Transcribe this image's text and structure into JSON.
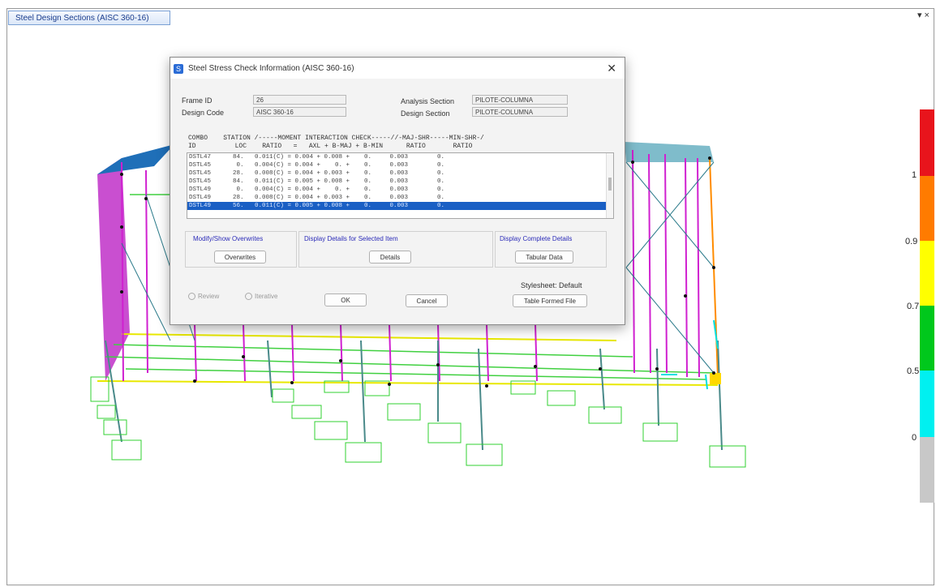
{
  "window": {
    "tab_title": "Steel Design Sections (AISC 360-16)",
    "controls": "▾ ×"
  },
  "legend": {
    "colors": [
      "#e8141c",
      "#ff7b00",
      "#ffff00",
      "#00c81c",
      "#00f0f0",
      "#c8c8c8"
    ],
    "labels": [
      "1",
      "0.9",
      "0.7",
      "0.5",
      "0"
    ]
  },
  "dialog": {
    "title": "Steel Stress Check Information (AISC 360-16)",
    "close": "✕",
    "frame_id_label": "Frame ID",
    "frame_id_value": "26",
    "design_code_label": "Design Code",
    "design_code_value": "AISC 360-16",
    "analysis_section_label": "Analysis Section",
    "analysis_section_value": "PILOTE-COLUMNA",
    "design_section_label": "Design Section",
    "design_section_value": "PILOTE-COLUMNA",
    "header_line1": "COMBO    STATION /-----MOMENT INTERACTION CHECK-----//-MAJ-SHR-----MIN-SHR-/",
    "header_line2": "ID          LOC    RATIO   =   AXL + B-MAJ + B-MIN      RATIO       RATIO",
    "rows": [
      "DSTL47      84.   0.011(C) = 0.004 + 0.008 +    0.     0.003        0.",
      "DSTL45       0.   0.004(C) = 0.004 +    0. +    0.     0.003        0.",
      "DSTL45      28.   0.008(C) = 0.004 + 0.003 +    0.     0.003        0.",
      "DSTL45      84.   0.011(C) = 0.005 + 0.008 +    0.     0.003        0.",
      "DSTL49       0.   0.004(C) = 0.004 +    0. +    0.     0.003        0.",
      "DSTL49      28.   0.008(C) = 0.004 + 0.003 +    0.     0.003        0.",
      "DSTL49      56.   0.011(C) = 0.005 + 0.008 +    0.     0.003        0."
    ],
    "groups": {
      "overwrites_title": "Modify/Show Overwrites",
      "overwrites_button": "Overwrites",
      "details_title": "Display Details for Selected Item",
      "details_button": "Details",
      "complete_title": "Display Complete Details",
      "tabular_button": "Tabular Data"
    },
    "stylesheet_label": "Stylesheet: Default",
    "radio_review": "Review",
    "radio_iterative": "Iterative",
    "ok_button": "OK",
    "cancel_button": "Cancel",
    "table_file_button": "Table Formed File"
  }
}
